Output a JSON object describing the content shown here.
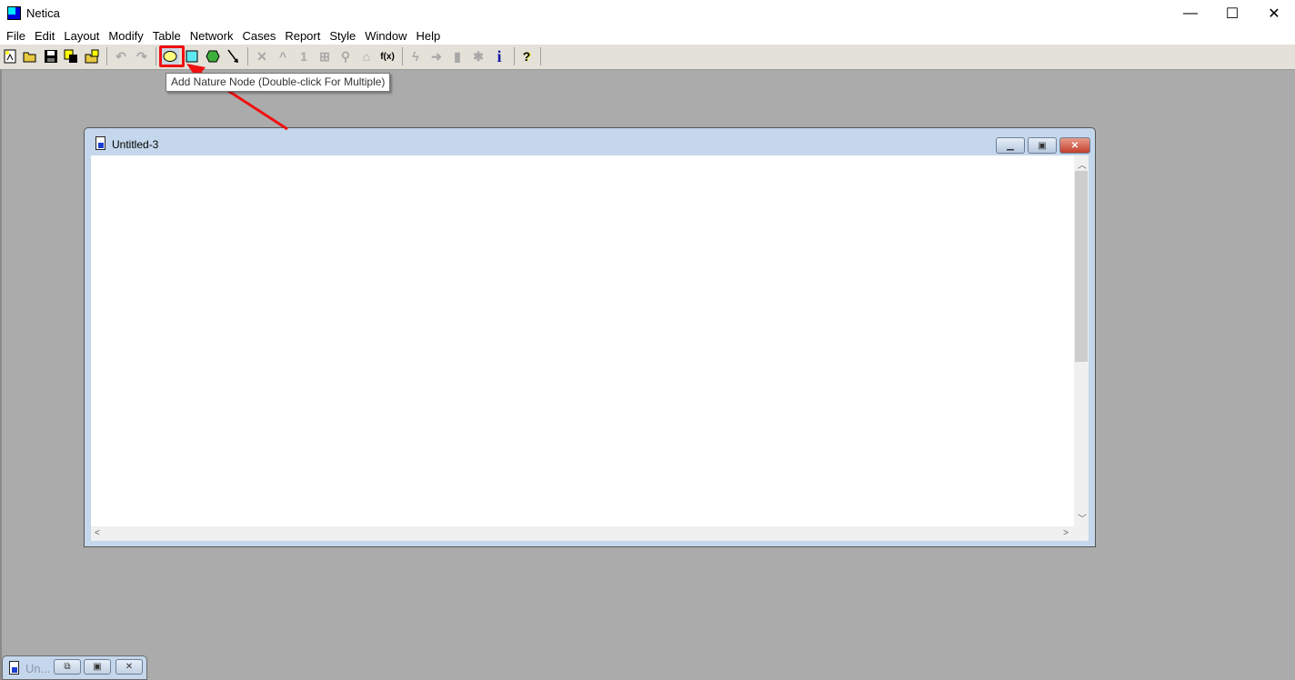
{
  "app": {
    "title": "Netica",
    "controls": {
      "minimize": "—",
      "maximize": "☐",
      "close": "✕"
    }
  },
  "menu": [
    "File",
    "Edit",
    "Layout",
    "Modify",
    "Table",
    "Network",
    "Cases",
    "Report",
    "Style",
    "Window",
    "Help"
  ],
  "toolbar": {
    "file_tools": [
      "new-network",
      "open",
      "save",
      "save-all",
      "save-as"
    ],
    "edit_tools": [
      "undo",
      "redo"
    ],
    "node_tools": [
      "nature-node",
      "decision-node",
      "utility-node",
      "add-link"
    ],
    "highlighted_tool": "nature-node",
    "tooltip": "Add Nature Node (Double-click For Multiple)",
    "info_glyph": "i",
    "help_glyph": "?",
    "highlight_color": "#f01010"
  },
  "child_window": {
    "title": "Untitled-3",
    "minimize": "▁",
    "restore": "▣",
    "close": "✕"
  },
  "minimized_window": {
    "title": "Un...",
    "restore": "⧉",
    "maximize": "▣",
    "close": "✕"
  }
}
